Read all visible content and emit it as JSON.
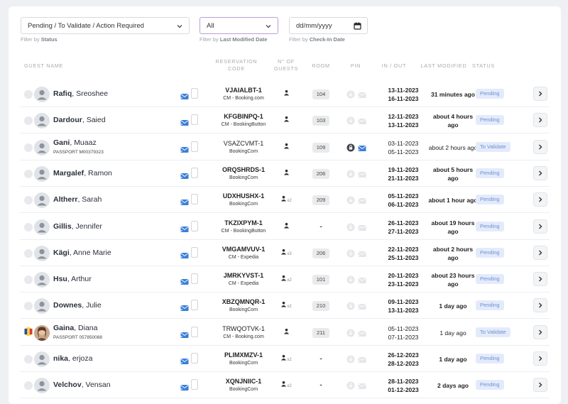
{
  "filters": {
    "status": {
      "value": "Pending / To Validate / Action Required",
      "caption_prefix": "Filter by",
      "caption_field": "Status"
    },
    "modified": {
      "value": "All",
      "caption_prefix": "Filter by",
      "caption_field": "Last Modified Date"
    },
    "checkin": {
      "placeholder": "dd/mm/yyyy",
      "caption_prefix": "Filter by",
      "caption_field": "Check-In Date"
    }
  },
  "columns": {
    "guest": "Guest Name",
    "code_1": "Reservation",
    "code_2": "Code",
    "guests_1": "N° of",
    "guests_2": "Guests",
    "room": "Room",
    "pin": "Pin",
    "inout": "In / Out",
    "modified": "Last Modified",
    "status": "Status"
  },
  "colors": {
    "status_bg": "#e3ebfb",
    "status_text": "#6f8fd3",
    "mail_icon": "#3b7fd9"
  },
  "rows": [
    {
      "last": "Rafiq",
      "first": "Sreoshee",
      "passport": "",
      "code": "VJAIALBT-1",
      "channel": "CM - Booking.com",
      "code_bold": true,
      "guests": "",
      "room": "104",
      "pin_active": false,
      "in": "13-11-2023",
      "out": "16-11-2023",
      "dates_bold": true,
      "modified_1": "31 minutes ago",
      "modified_2": "",
      "modified_bold": true,
      "status": "Pending",
      "flag": false
    },
    {
      "last": "Dardour",
      "first": "Saied",
      "passport": "",
      "code": "KFGBINPQ-1",
      "channel": "CM - BookingButton",
      "code_bold": true,
      "guests": "",
      "room": "103",
      "pin_active": false,
      "in": "12-11-2023",
      "out": "13-11-2023",
      "dates_bold": true,
      "modified_1": "about 4 hours",
      "modified_2": "ago",
      "modified_bold": true,
      "status": "Pending",
      "flag": false
    },
    {
      "last": "Gani",
      "first": "Muaaz",
      "passport": "PASSPORT M00379323",
      "code": "VSAZCVMT-1",
      "channel": "BookingCom",
      "code_bold": false,
      "guests": "",
      "room": "109",
      "pin_active": true,
      "in": "03-11-2023",
      "out": "05-11-2023",
      "dates_bold": false,
      "modified_1": "about 2 hours ago",
      "modified_2": "",
      "modified_bold": false,
      "status": "To Validate",
      "flag": false
    },
    {
      "last": "Margalef",
      "first": "Ramon",
      "passport": "",
      "code": "ORQSHRDS-1",
      "channel": "BookingCom",
      "code_bold": true,
      "guests": "",
      "room": "206",
      "pin_active": false,
      "in": "19-11-2023",
      "out": "21-11-2023",
      "dates_bold": true,
      "modified_1": "about 5 hours",
      "modified_2": "ago",
      "modified_bold": true,
      "status": "Pending",
      "flag": false
    },
    {
      "last": "Altherr",
      "first": "Sarah",
      "passport": "",
      "code": "UDXHUSHX-1",
      "channel": "BookingCom",
      "code_bold": true,
      "guests": "x2",
      "room": "209",
      "pin_active": false,
      "in": "05-11-2023",
      "out": "06-11-2023",
      "dates_bold": true,
      "modified_1": "about 1 hour ago",
      "modified_2": "",
      "modified_bold": true,
      "status": "Pending",
      "flag": false
    },
    {
      "last": "Gillis",
      "first": "Jennifer",
      "passport": "",
      "code": "TKZIXPYM-1",
      "channel": "CM - BookingButton",
      "code_bold": true,
      "guests": "",
      "room": "-",
      "pin_active": false,
      "in": "26-11-2023",
      "out": "27-11-2023",
      "dates_bold": true,
      "modified_1": "about 19 hours",
      "modified_2": "ago",
      "modified_bold": true,
      "status": "Pending",
      "flag": false
    },
    {
      "last": "Kägi",
      "first": "Anne Marie",
      "passport": "",
      "code": "VMGAMVUV-1",
      "channel": "CM - Expedia",
      "code_bold": true,
      "guests": "x3",
      "room": "206",
      "pin_active": false,
      "in": "22-11-2023",
      "out": "25-11-2023",
      "dates_bold": true,
      "modified_1": "about 2 hours",
      "modified_2": "ago",
      "modified_bold": true,
      "status": "Pending",
      "flag": false
    },
    {
      "last": "Hsu",
      "first": "Arthur",
      "passport": "",
      "code": "JMRKYVST-1",
      "channel": "CM - Expedia",
      "code_bold": true,
      "guests": "x2",
      "room": "101",
      "pin_active": false,
      "in": "20-11-2023",
      "out": "23-11-2023",
      "dates_bold": true,
      "modified_1": "about 23 hours",
      "modified_2": "ago",
      "modified_bold": true,
      "status": "Pending",
      "flag": false
    },
    {
      "last": "Downes",
      "first": "Julie",
      "passport": "",
      "code": "XBZQMNQR-1",
      "channel": "BookingCom",
      "code_bold": true,
      "guests": "x2",
      "room": "210",
      "pin_active": false,
      "in": "09-11-2023",
      "out": "13-11-2023",
      "dates_bold": true,
      "modified_1": "1 day ago",
      "modified_2": "",
      "modified_bold": true,
      "status": "Pending",
      "flag": false
    },
    {
      "last": "Gaina",
      "first": "Diana",
      "passport": "PASSPORT 057850088",
      "code": "TRWQOTVK-1",
      "channel": "CM - Booking.com",
      "code_bold": false,
      "guests": "",
      "room": "211",
      "pin_active": false,
      "in": "05-11-2023",
      "out": "07-11-2023",
      "dates_bold": false,
      "modified_1": "1 day ago",
      "modified_2": "",
      "modified_bold": false,
      "status": "To Validate",
      "flag": true
    },
    {
      "last": "nika",
      "first": "erjoza",
      "passport": "",
      "code": "PLIMXMZV-1",
      "channel": "BookingCom",
      "code_bold": true,
      "guests": "x2",
      "room": "-",
      "pin_active": false,
      "in": "26-12-2023",
      "out": "28-12-2023",
      "dates_bold": true,
      "modified_1": "1 day ago",
      "modified_2": "",
      "modified_bold": true,
      "status": "Pending",
      "flag": false
    },
    {
      "last": "Velchov",
      "first": "Vensan",
      "passport": "",
      "code": "XQNJNIIC-1",
      "channel": "BookingCom",
      "code_bold": true,
      "guests": "x2",
      "room": "-",
      "pin_active": false,
      "in": "28-11-2023",
      "out": "01-12-2023",
      "dates_bold": true,
      "modified_1": "2 days ago",
      "modified_2": "",
      "modified_bold": true,
      "status": "Pending",
      "flag": false
    }
  ]
}
